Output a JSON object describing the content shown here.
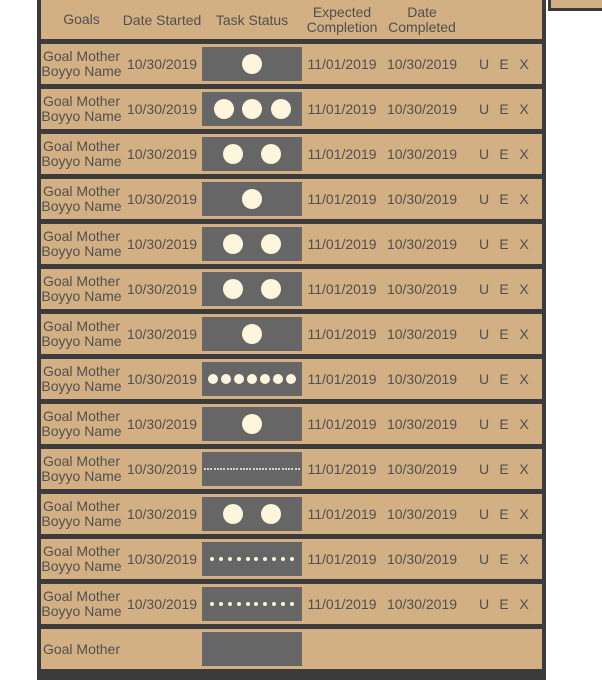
{
  "header": {
    "goals": "Goals",
    "date_started": "Date Started",
    "task_status": "Task Status",
    "expected_completion": "Expected Completion",
    "date_completed": "Date Completed"
  },
  "rows": [
    {
      "goal": "Goal Mother Boyyo Name",
      "date_started": "10/30/2019",
      "status_dots": 1,
      "expected": "11/01/2019",
      "completed": "10/30/2019",
      "u": "U",
      "e": "E",
      "x": "X"
    },
    {
      "goal": "Goal Mother Boyyo Name",
      "date_started": "10/30/2019",
      "status_dots": 3,
      "expected": "11/01/2019",
      "completed": "10/30/2019",
      "u": "U",
      "e": "E",
      "x": "X"
    },
    {
      "goal": "Goal Mother Boyyo Name",
      "date_started": "10/30/2019",
      "status_dots": 2,
      "expected": "11/01/2019",
      "completed": "10/30/2019",
      "u": "U",
      "e": "E",
      "x": "X"
    },
    {
      "goal": "Goal Mother Boyyo Name",
      "date_started": "10/30/2019",
      "status_dots": 1,
      "expected": "11/01/2019",
      "completed": "10/30/2019",
      "u": "U",
      "e": "E",
      "x": "X"
    },
    {
      "goal": "Goal Mother Boyyo Name",
      "date_started": "10/30/2019",
      "status_dots": 2,
      "expected": "11/01/2019",
      "completed": "10/30/2019",
      "u": "U",
      "e": "E",
      "x": "X"
    },
    {
      "goal": "Goal Mother Boyyo Name",
      "date_started": "10/30/2019",
      "status_dots": 2,
      "expected": "11/01/2019",
      "completed": "10/30/2019",
      "u": "U",
      "e": "E",
      "x": "X"
    },
    {
      "goal": "Goal Mother Boyyo Name",
      "date_started": "10/30/2019",
      "status_dots": 1,
      "expected": "11/01/2019",
      "completed": "10/30/2019",
      "u": "U",
      "e": "E",
      "x": "X"
    },
    {
      "goal": "Goal Mother Boyyo Name",
      "date_started": "10/30/2019",
      "status_dots": 7,
      "expected": "11/01/2019",
      "completed": "10/30/2019",
      "u": "U",
      "e": "E",
      "x": "X"
    },
    {
      "goal": "Goal Mother Boyyo Name",
      "date_started": "10/30/2019",
      "status_dots": 1,
      "expected": "11/01/2019",
      "completed": "10/30/2019",
      "u": "U",
      "e": "E",
      "x": "X"
    },
    {
      "goal": "Goal Mother Boyyo Name",
      "date_started": "10/30/2019",
      "status_dots": 30,
      "expected": "11/01/2019",
      "completed": "10/30/2019",
      "u": "U",
      "e": "E",
      "x": "X"
    },
    {
      "goal": "Goal Mother Boyyo Name",
      "date_started": "10/30/2019",
      "status_dots": 2,
      "expected": "11/01/2019",
      "completed": "10/30/2019",
      "u": "U",
      "e": "E",
      "x": "X"
    },
    {
      "goal": "Goal Mother Boyyo Name",
      "date_started": "10/30/2019",
      "status_dots": 10,
      "expected": "11/01/2019",
      "completed": "10/30/2019",
      "u": "U",
      "e": "E",
      "x": "X"
    },
    {
      "goal": "Goal Mother Boyyo Name",
      "date_started": "10/30/2019",
      "status_dots": 10,
      "expected": "11/01/2019",
      "completed": "10/30/2019",
      "u": "U",
      "e": "E",
      "x": "X"
    },
    {
      "goal": "Goal Mother",
      "date_started": "",
      "status_dots": 0,
      "expected": "",
      "completed": "",
      "u": "",
      "e": "",
      "x": ""
    }
  ],
  "colors": {
    "row_bg": "#d3b083",
    "frame": "#3b3b3b",
    "status_bg": "#666666",
    "dot": "#fdf5dc",
    "text": "#505050"
  }
}
